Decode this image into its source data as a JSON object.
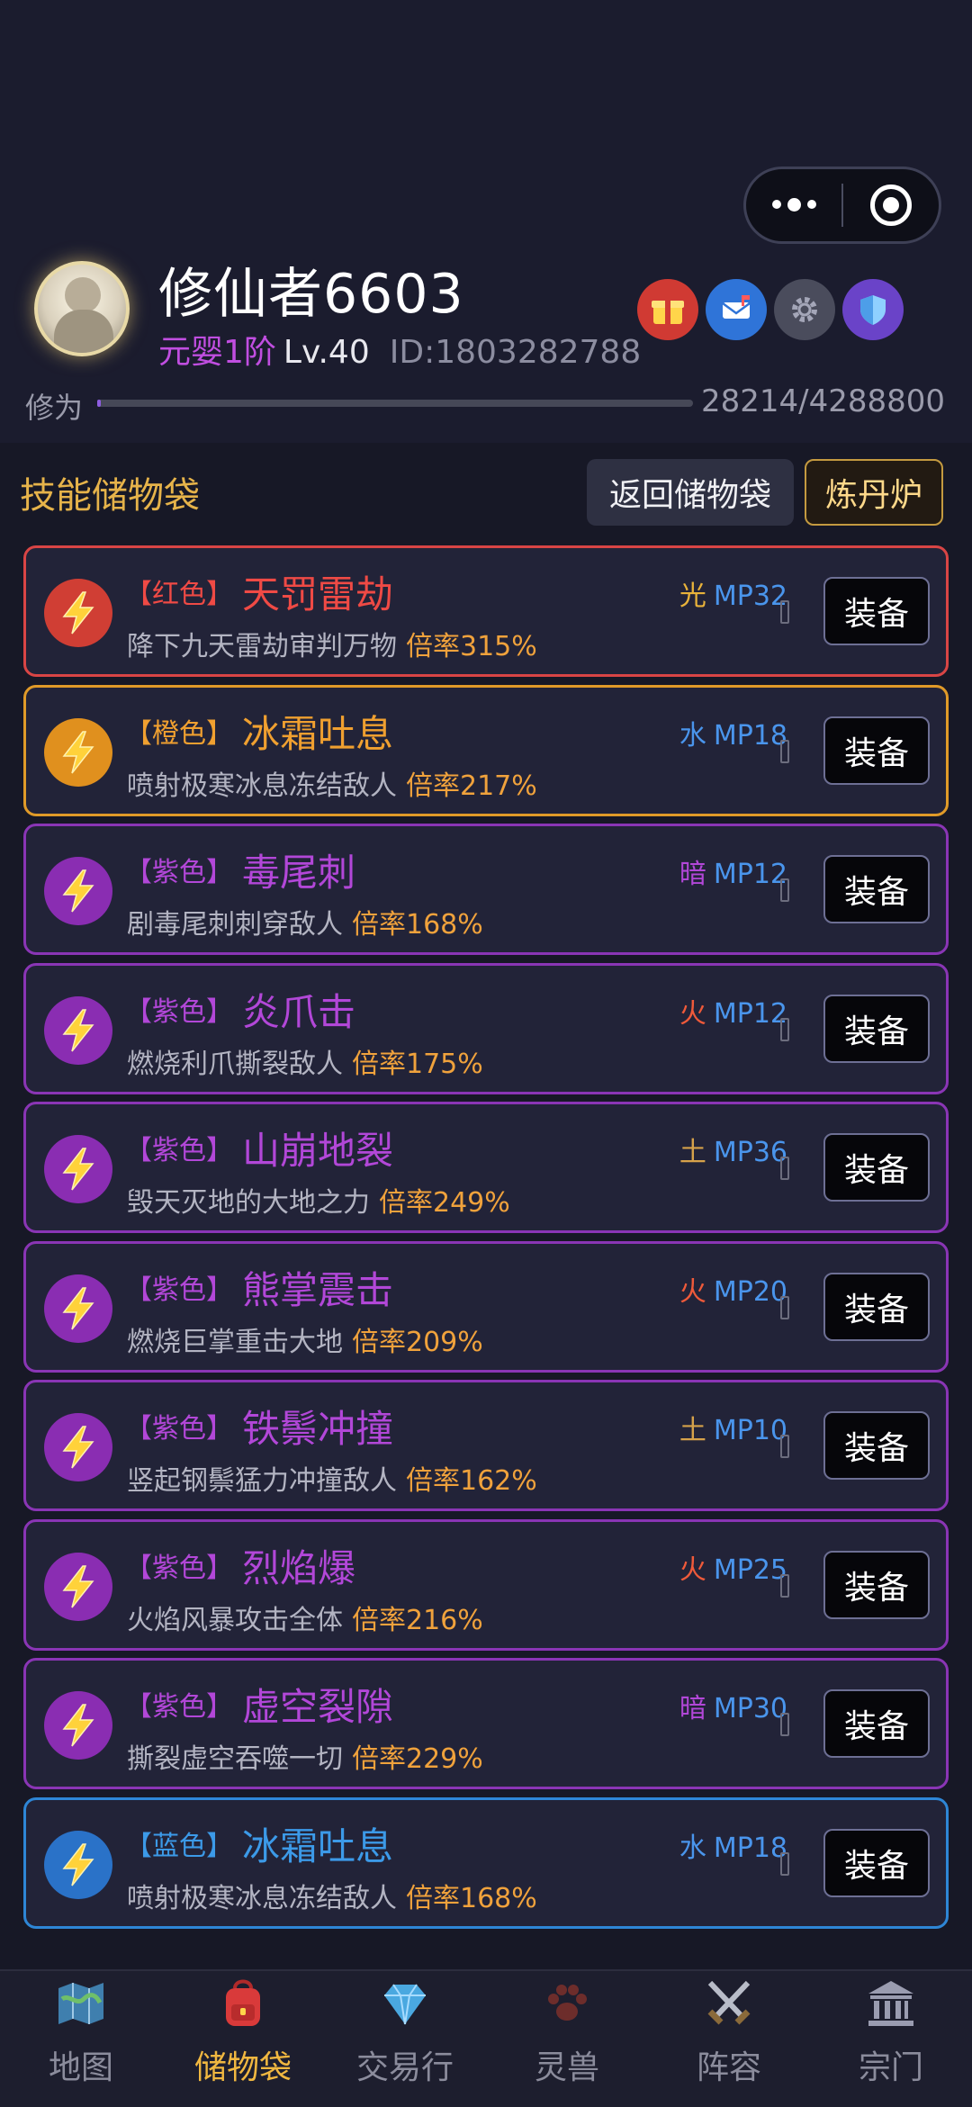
{
  "header": {
    "username": "修仙者6603",
    "realm": "元婴1阶",
    "level": "Lv.40",
    "user_id": "ID:1803282788",
    "cultivation_label": "修为",
    "cultivation_value": "28214/4288800",
    "cultivation_progress": 0.0066,
    "icons": [
      "gift-icon",
      "mailbox-icon",
      "gear-icon",
      "shield-icon"
    ]
  },
  "section": {
    "title": "技能储物袋",
    "back_label": "返回储物袋",
    "furnace_label": "炼丹炉"
  },
  "skills": [
    {
      "quality": "【红色】",
      "name": "天罚雷劫",
      "desc": "降下九天雷劫审判万物",
      "rate": "倍率315%",
      "element": "光",
      "mp": "MP32",
      "equip": "装备"
    },
    {
      "quality": "【橙色】",
      "name": "冰霜吐息",
      "desc": "喷射极寒冰息冻结敌人",
      "rate": "倍率217%",
      "element": "水",
      "mp": "MP18",
      "equip": "装备"
    },
    {
      "quality": "【紫色】",
      "name": "毒尾刺",
      "desc": "剧毒尾刺刺穿敌人",
      "rate": "倍率168%",
      "element": "暗",
      "mp": "MP12",
      "equip": "装备"
    },
    {
      "quality": "【紫色】",
      "name": "炎爪击",
      "desc": "燃烧利爪撕裂敌人",
      "rate": "倍率175%",
      "element": "火",
      "mp": "MP12",
      "equip": "装备"
    },
    {
      "quality": "【紫色】",
      "name": "山崩地裂",
      "desc": "毁天灭地的大地之力",
      "rate": "倍率249%",
      "element": "土",
      "mp": "MP36",
      "equip": "装备"
    },
    {
      "quality": "【紫色】",
      "name": "熊掌震击",
      "desc": "燃烧巨掌重击大地",
      "rate": "倍率209%",
      "element": "火",
      "mp": "MP20",
      "equip": "装备"
    },
    {
      "quality": "【紫色】",
      "name": "铁鬃冲撞",
      "desc": "竖起钢鬃猛力冲撞敌人",
      "rate": "倍率162%",
      "element": "土",
      "mp": "MP10",
      "equip": "装备"
    },
    {
      "quality": "【紫色】",
      "name": "烈焰爆",
      "desc": "火焰风暴攻击全体",
      "rate": "倍率216%",
      "element": "火",
      "mp": "MP25",
      "equip": "装备"
    },
    {
      "quality": "【紫色】",
      "name": "虚空裂隙",
      "desc": "撕裂虚空吞噬一切",
      "rate": "倍率229%",
      "element": "暗",
      "mp": "MP30",
      "equip": "装备"
    },
    {
      "quality": "【蓝色】",
      "name": "冰霜吐息",
      "desc": "喷射极寒冰息冻结敌人",
      "rate": "倍率168%",
      "element": "水",
      "mp": "MP18",
      "equip": "装备"
    }
  ],
  "nav": [
    {
      "label": "地图",
      "icon": "map-icon"
    },
    {
      "label": "储物袋",
      "icon": "backpack-icon",
      "active": true
    },
    {
      "label": "交易行",
      "icon": "diamond-icon"
    },
    {
      "label": "灵兽",
      "icon": "paw-icon"
    },
    {
      "label": "阵容",
      "icon": "crossed-swords-icon"
    },
    {
      "label": "宗门",
      "icon": "temple-icon"
    }
  ],
  "colors": {
    "element_light": "#e8b23a",
    "element_water": "#4a95ec",
    "element_dark": "#b247d8",
    "element_fire": "#ef5a3a",
    "element_earth": "#d6a24a"
  }
}
